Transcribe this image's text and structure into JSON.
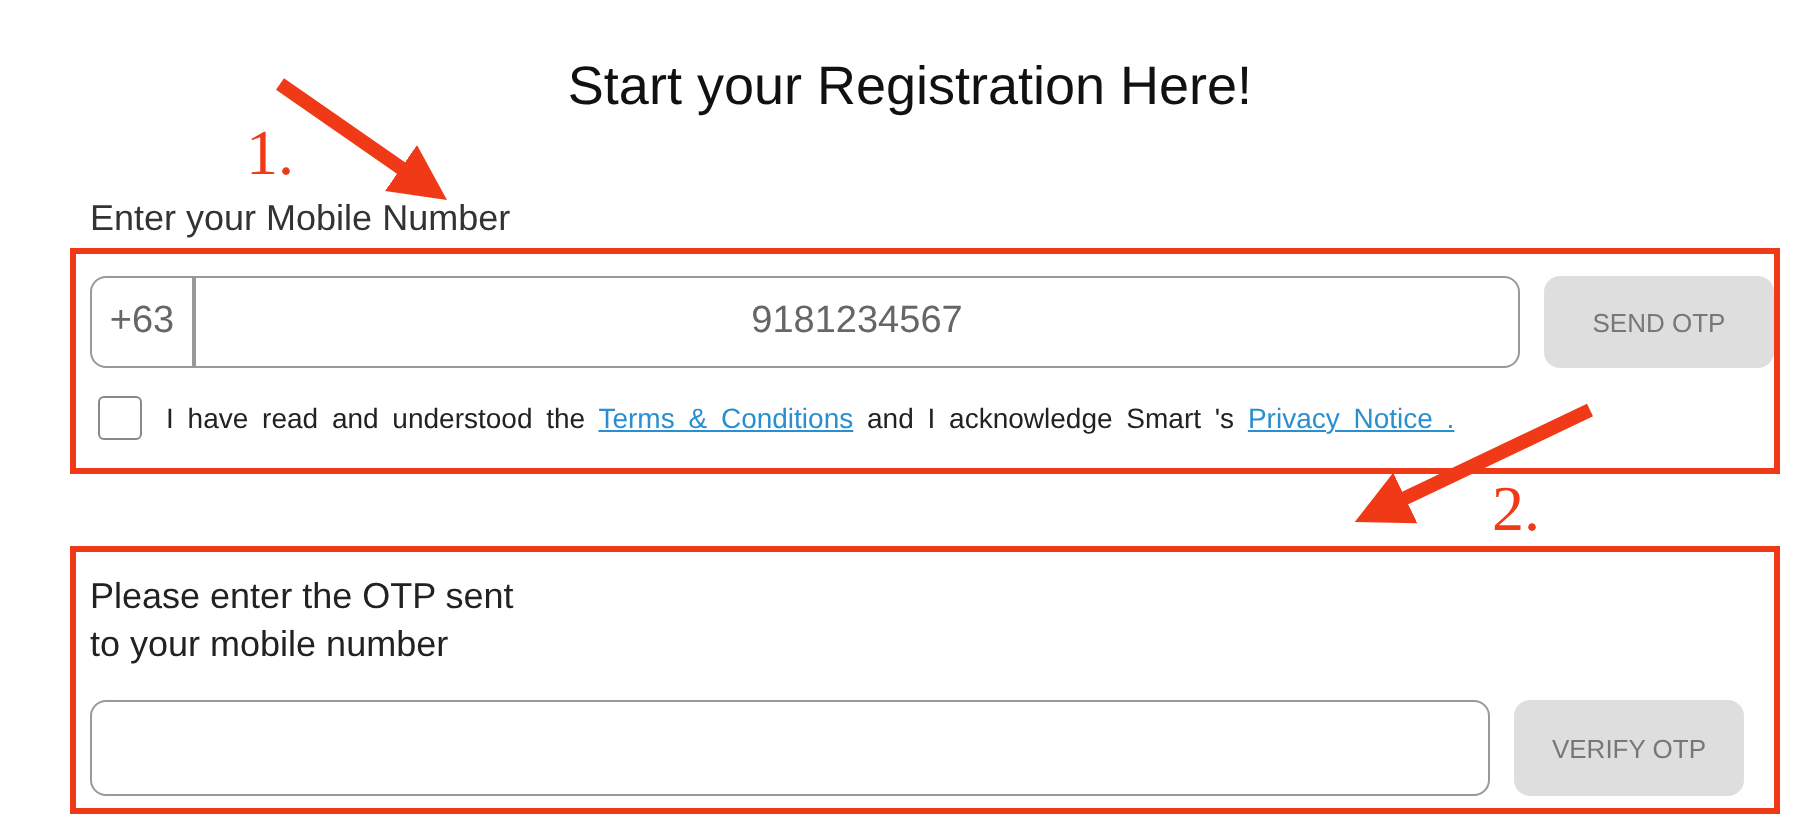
{
  "title": "Start your Registration Here!",
  "mobile_section": {
    "highlighted": true,
    "label": "Enter your Mobile Number",
    "country_code": "+63",
    "phone": {
      "value": "9181234567"
    },
    "send_button": {
      "label": "SEND OTP",
      "disabled": true
    },
    "consent": {
      "checked": false,
      "text_1": "I have read and understood the",
      "link_1": "Terms & Conditions",
      "text_2": "and I acknowledge Smart 's",
      "link_2": "Privacy Notice ."
    }
  },
  "otp_section": {
    "highlighted": true,
    "label_lines": [
      "Please enter the OTP sent",
      "to your mobile number"
    ],
    "verify_button": {
      "label": "VERIFY OTP",
      "disabled": true
    }
  },
  "annotations": [
    {
      "label": "1."
    },
    {
      "label": "2."
    }
  ]
}
